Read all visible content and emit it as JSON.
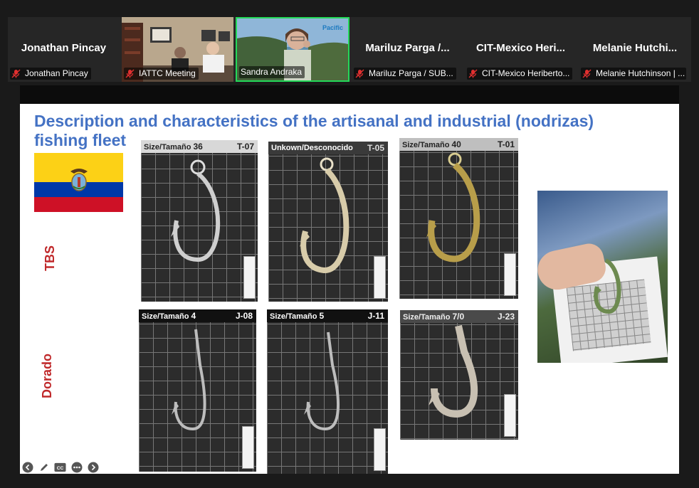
{
  "participants": [
    {
      "display_name": "Jonathan Pincay",
      "label": "Jonathan Pincay",
      "muted": true,
      "video": false
    },
    {
      "display_name": "",
      "label": "IATTC Meeting",
      "muted": true,
      "video": true
    },
    {
      "display_name": "",
      "label": "Sandra Andraka",
      "muted": false,
      "video": true,
      "active_speaker": true
    },
    {
      "display_name": "Mariluz Parga /...",
      "label": "Mariluz Parga / SUB...",
      "muted": true,
      "video": false
    },
    {
      "display_name": "CIT-Mexico Heri...",
      "label": "CIT-Mexico Heriberto...",
      "muted": true,
      "video": false
    },
    {
      "display_name": "Melanie Hutchi...",
      "label": "Melanie Hutchinson | ...",
      "muted": true,
      "video": false
    }
  ],
  "slide": {
    "title": "Description and characteristics of the artisanal and industrial (nodrizas) fishing fleet",
    "row_labels": [
      "TBS",
      "Dorado"
    ],
    "cards": [
      {
        "size_label": "Size/Tamaño",
        "size_value": "36",
        "code": "T-07"
      },
      {
        "size_label": "Unkown/Desconocido",
        "size_value": "",
        "code": "T-05"
      },
      {
        "size_label": "Size/Tamaño",
        "size_value": "40",
        "code": "T-01"
      },
      {
        "size_label": "Size/Tamaño",
        "size_value": "4",
        "code": "J-08"
      },
      {
        "size_label": "Size/Tamaño",
        "size_value": "5",
        "code": "J-11"
      },
      {
        "size_label": "Size/Tamaño",
        "size_value": "7/0",
        "code": "J-23"
      }
    ]
  },
  "controls": [
    "back-icon",
    "pen-icon",
    "cc-icon",
    "more-icon",
    "forward-icon"
  ],
  "colors": {
    "title": "#4472c4",
    "row_label": "#c0292b",
    "active_border": "#23d959"
  }
}
